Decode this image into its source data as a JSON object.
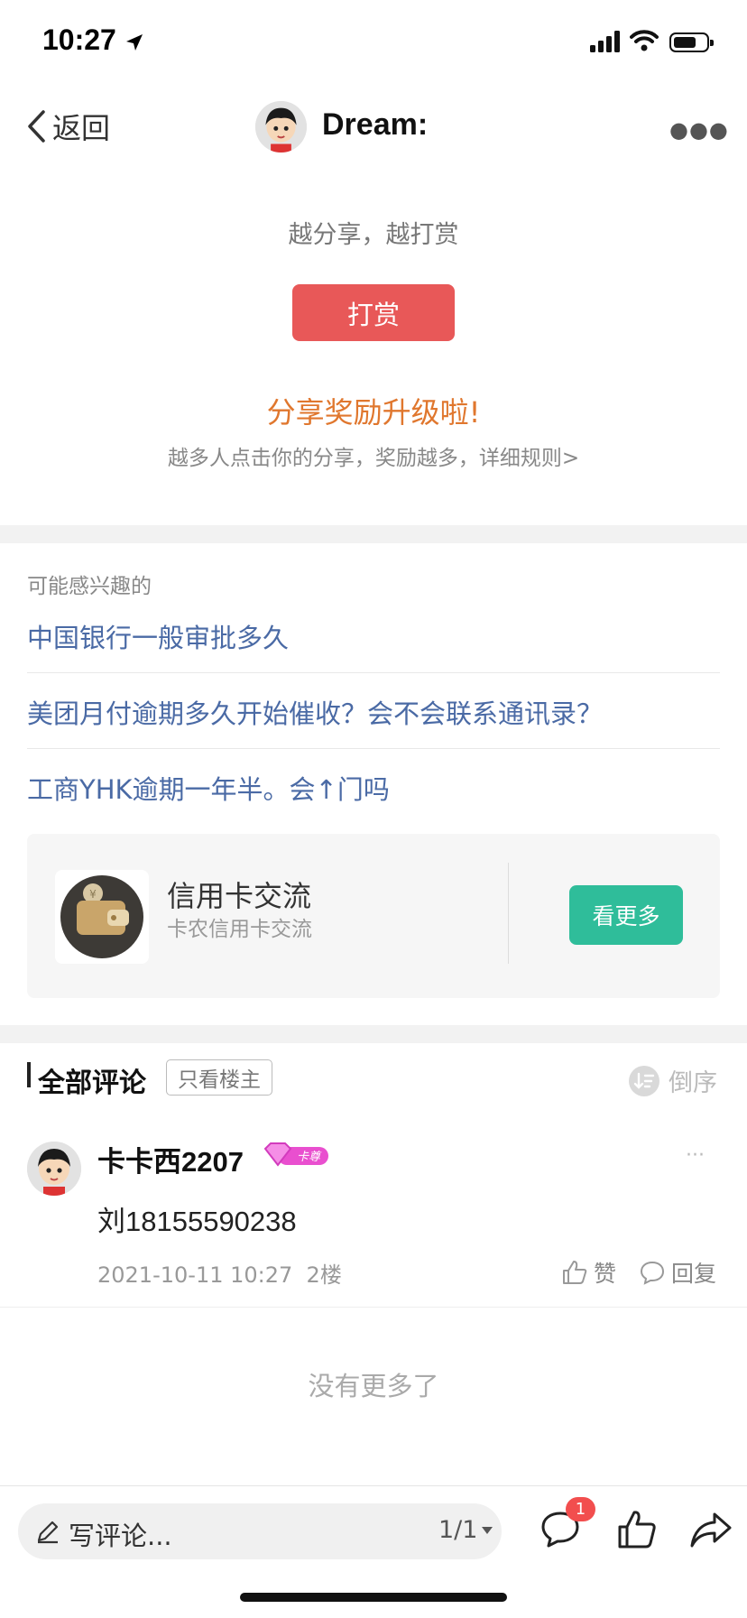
{
  "status_bar": {
    "time": "10:27"
  },
  "nav": {
    "back_label": "返回",
    "user_name": "Dream:"
  },
  "reward": {
    "slogan": "越分享，越打赏",
    "button_label": "打赏",
    "upgrade_title": "分享奖励升级啦!",
    "rules_text": "越多人点击你的分享，奖励越多，详细规则>"
  },
  "interest": {
    "title": "可能感兴趣的",
    "items": [
      "中国银行一般审批多久",
      "美团月付逾期多久开始催收？会不会联系通讯录？",
      "工商YHK逾期一年半。会↑门吗"
    ]
  },
  "community_card": {
    "title": "信用卡交流",
    "subtitle": "卡农信用卡交流",
    "button_label": "看更多"
  },
  "comments": {
    "title": "全部评论",
    "owner_only_label": "只看楼主",
    "sort_label": "倒序",
    "items": [
      {
        "user": "卡卡西2207",
        "badge_text": "卡尊",
        "text": "刘18155590238",
        "date": "2021-10-11 10:27",
        "floor": "2楼",
        "like_label": "赞",
        "reply_label": "回复"
      }
    ],
    "end_text": "没有更多了"
  },
  "bottom_bar": {
    "input_placeholder": "写评论...",
    "page_indicator": "1/1",
    "comment_badge": "1"
  },
  "colors": {
    "accent_red": "#e85858",
    "accent_teal": "#2fbd9a",
    "link_blue": "#4a6aa5",
    "orange": "#e0772e"
  },
  "icons": [
    "back-chevron-icon",
    "location-arrow-icon",
    "signal-icon",
    "wifi-icon",
    "battery-icon",
    "more-icon",
    "wallet-icon",
    "sort-icon",
    "diamond-badge-icon",
    "thumb-up-icon",
    "comment-icon",
    "pencil-icon",
    "caret-down-icon",
    "share-icon"
  ]
}
